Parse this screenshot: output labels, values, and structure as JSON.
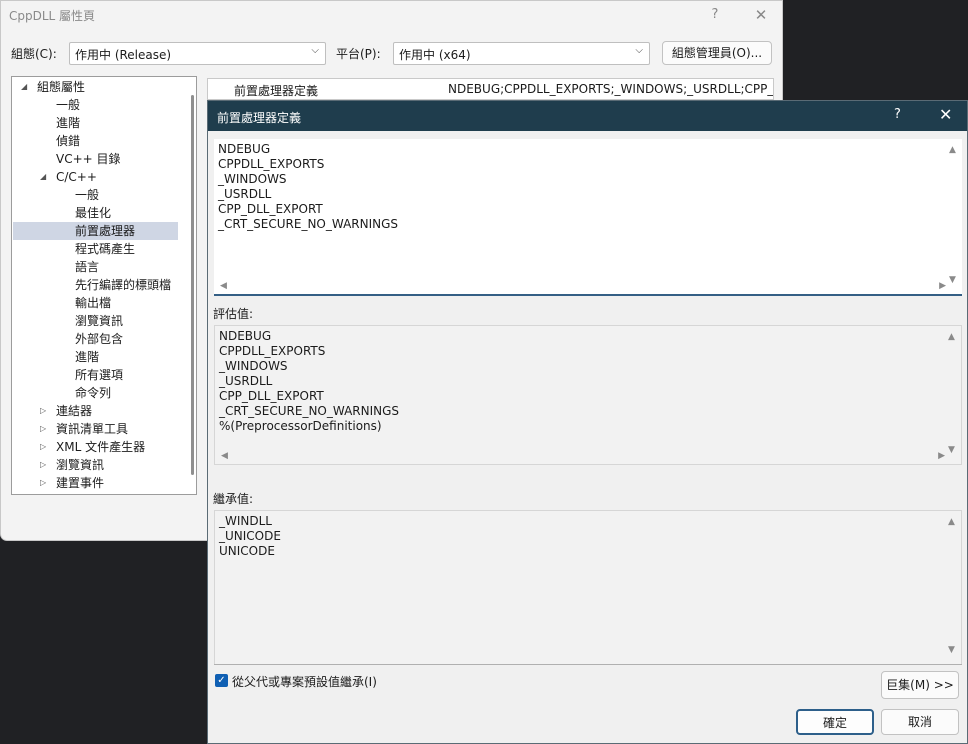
{
  "property_window": {
    "title": "CppDLL 屬性頁",
    "help_glyph": "?",
    "close_glyph": "✕",
    "config_label": "組態(C):",
    "config_value": "作用中 (Release)",
    "platform_label": "平台(P):",
    "platform_value": "作用中 (x64)",
    "config_manager_label": "組態管理員(O)...",
    "tree": [
      {
        "label": "組態屬性",
        "toggle": "◢"
      },
      {
        "label": "一般",
        "toggle": ""
      },
      {
        "label": "進階",
        "toggle": ""
      },
      {
        "label": "偵錯",
        "toggle": ""
      },
      {
        "label": "VC++ 目錄",
        "toggle": ""
      },
      {
        "label": "C/C++",
        "toggle": "◢"
      },
      {
        "label": "一般",
        "toggle": ""
      },
      {
        "label": "最佳化",
        "toggle": ""
      },
      {
        "label": "前置處理器",
        "toggle": ""
      },
      {
        "label": "程式碼產生",
        "toggle": ""
      },
      {
        "label": "語言",
        "toggle": ""
      },
      {
        "label": "先行編譯的標頭檔",
        "toggle": ""
      },
      {
        "label": "輸出檔",
        "toggle": ""
      },
      {
        "label": "瀏覽資訊",
        "toggle": ""
      },
      {
        "label": "外部包含",
        "toggle": ""
      },
      {
        "label": "進階",
        "toggle": ""
      },
      {
        "label": "所有選項",
        "toggle": ""
      },
      {
        "label": "命令列",
        "toggle": ""
      },
      {
        "label": "連結器",
        "toggle": "▷"
      },
      {
        "label": "資訊清單工具",
        "toggle": "▷"
      },
      {
        "label": "XML 文件產生器",
        "toggle": "▷"
      },
      {
        "label": "瀏覽資訊",
        "toggle": "▷"
      },
      {
        "label": "建置事件",
        "toggle": "▷"
      }
    ],
    "grid_row": {
      "name": "前置處理器定義",
      "value": "NDEBUG;CPPDLL_EXPORTS;_WINDOWS;_USRDLL;CPP_D"
    }
  },
  "dialog": {
    "title": "前置處理器定義",
    "help_glyph": "?",
    "close_glyph": "✕",
    "edit_text": "NDEBUG\nCPPDLL_EXPORTS\n_WINDOWS\n_USRDLL\nCPP_DLL_EXPORT\n_CRT_SECURE_NO_WARNINGS",
    "evaluated_label": "評估值:",
    "evaluated_text": "NDEBUG\nCPPDLL_EXPORTS\n_WINDOWS\n_USRDLL\nCPP_DLL_EXPORT\n_CRT_SECURE_NO_WARNINGS\n%(PreprocessorDefinitions)",
    "inherited_label": "繼承值:",
    "inherited_text": "_WINDLL\n_UNICODE\nUNICODE",
    "inherit_checkbox_label": "從父代或專案預設值繼承(I)",
    "inherit_checked": true,
    "check_glyph": "✓",
    "macros_button": "巨集(M) >>",
    "ok_button": "確定",
    "cancel_button": "取消"
  },
  "glyphs": {
    "chevron_down": "⌵",
    "scroll_up": "▲",
    "scroll_down": "▼",
    "scroll_left": "◀",
    "scroll_right": "▶"
  },
  "colors": {
    "dialog_titlebar": "#1f3d4d",
    "selection": "#cfd6e4",
    "checkbox": "#0f5fb3",
    "edit_focus_line": "#345f85"
  }
}
